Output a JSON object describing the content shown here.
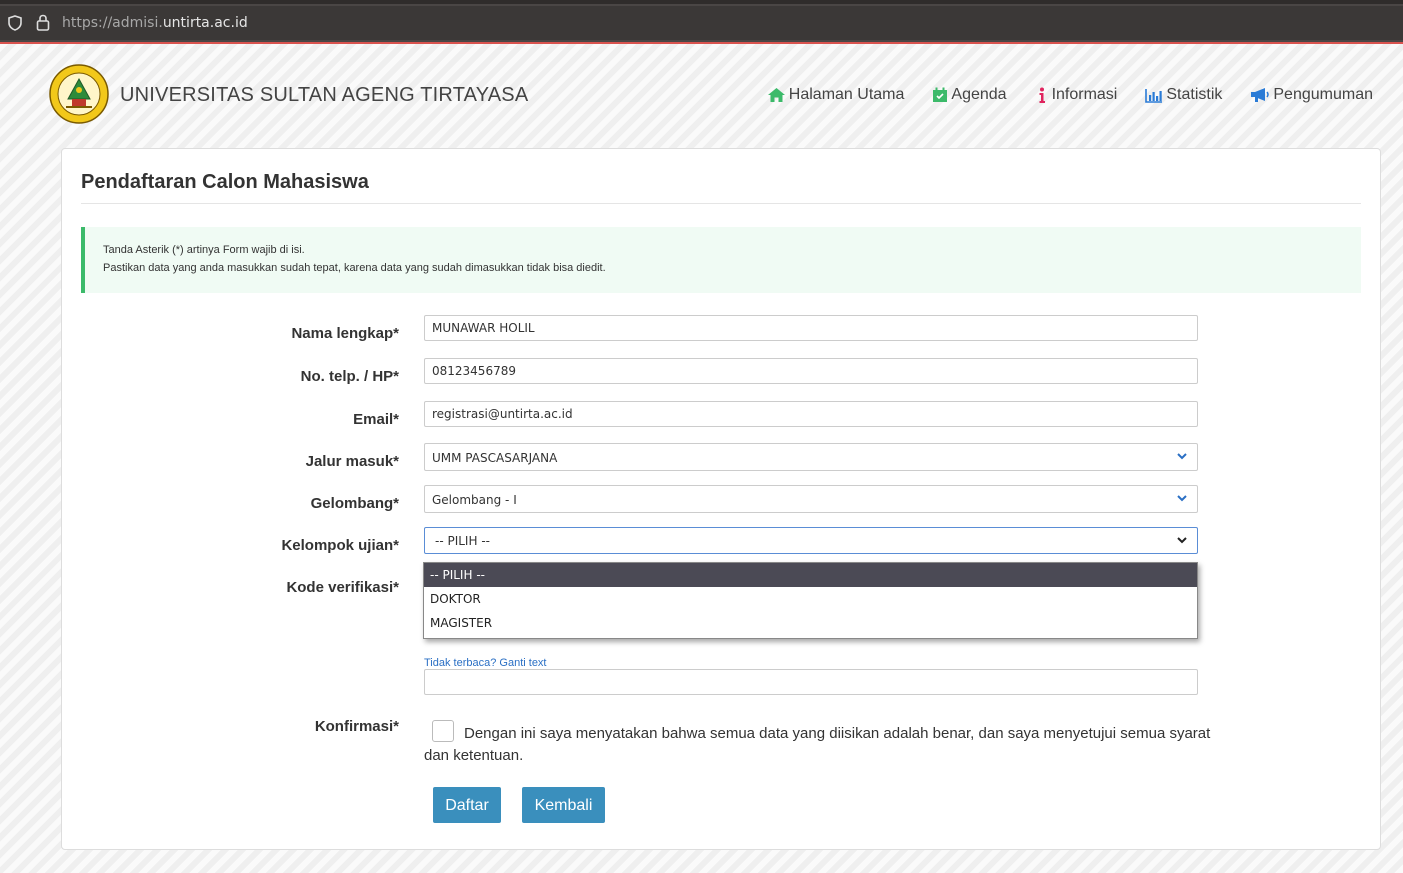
{
  "browser": {
    "url_protocol": "https://admisi.",
    "url_domain": "untirta.ac.id"
  },
  "header": {
    "university_name": "UNIVERSITAS SULTAN AGENG TIRTAYASA",
    "nav": [
      {
        "label": "Halaman Utama",
        "icon": "home-icon",
        "color": "#3cba6a"
      },
      {
        "label": "Agenda",
        "icon": "calendar-icon",
        "color": "#3cba6a"
      },
      {
        "label": "Informasi",
        "icon": "info-icon",
        "color": "#e0245e"
      },
      {
        "label": "Statistik",
        "icon": "bar-chart-icon",
        "color": "#2a7bd6"
      },
      {
        "label": "Pengumuman",
        "icon": "megaphone-icon",
        "color": "#2a7bd6"
      }
    ]
  },
  "form": {
    "title": "Pendaftaran Calon Mahasiswa",
    "notice": {
      "line1": "Tanda Asterik (*) artinya Form wajib di isi.",
      "line2": "Pastikan data yang anda masukkan sudah tepat, karena data yang sudah dimasukkan tidak bisa diedit."
    },
    "nama": {
      "label": "Nama lengkap*",
      "value": "MUNAWAR HOLIL"
    },
    "telp": {
      "label": "No. telp. / HP*",
      "value": "08123456789"
    },
    "email": {
      "label": "Email*",
      "value": "registrasi@untirta.ac.id"
    },
    "jalur": {
      "label": "Jalur masuk*",
      "value": "UMM PASCASARJANA"
    },
    "gelombang": {
      "label": "Gelombang*",
      "value": "Gelombang - I"
    },
    "kelompok": {
      "label": "Kelompok ujian*",
      "value": "-- PILIH --",
      "options": [
        "-- PILIH --",
        "DOKTOR",
        "MAGISTER"
      ]
    },
    "kode": {
      "label": "Kode verifikasi*",
      "reload_link": "Tidak terbaca? Ganti text",
      "value": ""
    },
    "konfirmasi": {
      "label": "Konfirmasi*",
      "text": "Dengan ini saya menyatakan bahwa semua data yang diisikan adalah benar, dan saya menyetujui semua syarat dan ketentuan."
    },
    "buttons": {
      "daftar": "Daftar",
      "kembali": "Kembali"
    }
  },
  "colors": {
    "accent": "#3a8fbd",
    "notice_border": "#3cba6a"
  }
}
